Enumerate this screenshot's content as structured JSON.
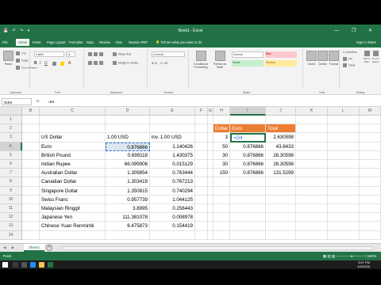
{
  "window": {
    "title": "Book1 - Excel",
    "controls": "— ❐ ✕",
    "qat": "💾 ↶ ↷ ▾"
  },
  "tabs": [
    "File",
    "Home",
    "Insert",
    "Page Layout",
    "Formulas",
    "Data",
    "Review",
    "View",
    "Nuance PDF"
  ],
  "active_tab": "Home",
  "tell_me": "Tell me what you want to do",
  "account": "Sign in  Share",
  "ribbon": {
    "clipboard": {
      "paste": "Paste",
      "cut": "Cut",
      "copy": "Copy",
      "format_painter": "Format Painter",
      "label": "Clipboard"
    },
    "font": {
      "name": "Calibri",
      "size": "11",
      "label": "Font"
    },
    "alignment": {
      "wrap": "Wrap Text",
      "merge": "Merge & Center",
      "label": "Alignment"
    },
    "number": {
      "format": "General",
      "label": "Number"
    },
    "styles": {
      "conditional": "Conditional Formatting",
      "format_table": "Format as Table",
      "normal": "Normal",
      "bad": "Bad",
      "good": "Good",
      "neutral": "Neutral",
      "label": "Styles"
    },
    "cells": {
      "insert": "Insert",
      "delete": "Delete",
      "format": "Format",
      "label": "Cells"
    },
    "editing": {
      "autosum": "AutoSum",
      "fill": "Fill",
      "clear": "Clear",
      "sort": "Sort & Filter",
      "find": "Find & Select",
      "label": "Editing"
    }
  },
  "formula_bar": {
    "name_box": "SUM",
    "fx": "fx",
    "formula": "=D4"
  },
  "columns": [
    "B",
    "C",
    "D",
    "E",
    "F",
    "G",
    "H",
    "I",
    "J",
    "K",
    "L",
    "M"
  ],
  "selected_column": "I",
  "rows": [
    "1",
    "2",
    "3",
    "4",
    "5",
    "6",
    "7",
    "8",
    "9",
    "10",
    "11",
    "12",
    "13",
    "14"
  ],
  "selected_row": "4",
  "currency_table": {
    "header_rate": "1.00 USD",
    "header_inv": "inv. 1.00 USD",
    "base": "US Dollar",
    "rows": [
      {
        "name": "Euro",
        "rate": "0.876866",
        "inv": "1.140426"
      },
      {
        "name": "British Pound",
        "rate": "0.699118",
        "inv": "1.430375"
      },
      {
        "name": "Indian Rupee",
        "rate": "66.099906",
        "inv": "0.015129"
      },
      {
        "name": "Australian Dollar",
        "rate": "1.309854",
        "inv": "0.763444"
      },
      {
        "name": "Canadian Dollar",
        "rate": "1.303419",
        "inv": "0.767213"
      },
      {
        "name": "Singapore Dollar",
        "rate": "1.350815",
        "inv": "0.740294"
      },
      {
        "name": "Swiss Franc",
        "rate": "0.957739",
        "inv": "1.044125"
      },
      {
        "name": "Malaysian Ringgit",
        "rate": "3.8995",
        "inv": "0.256443"
      },
      {
        "name": "Japanese Yen",
        "rate": "111.381078",
        "inv": "0.008978"
      },
      {
        "name": "Chinese Yuan Renminbi",
        "rate": "6.475873",
        "inv": "0.154419"
      }
    ]
  },
  "calc_table": {
    "headers": [
      "Dollar",
      "Euro",
      "Total"
    ],
    "rows": [
      {
        "dollar": "3",
        "euro": "=D4",
        "total": "2.630598"
      },
      {
        "dollar": "50",
        "euro": "0.876866",
        "total": "43.8433"
      },
      {
        "dollar": "30",
        "euro": "0.876866",
        "total": "26.30598"
      },
      {
        "dollar": "30",
        "euro": "0.876866",
        "total": "26.30598"
      },
      {
        "dollar": "150",
        "euro": "0.876866",
        "total": "131.5299"
      }
    ]
  },
  "sheet_tab": "Sheet1",
  "sheet_nav": "◀ ▶",
  "status": "Point",
  "zoom": "▦  ▥  ▤   — ────●──── +  160%",
  "clock": {
    "time": "3:57 PM",
    "date": "4/4/2016"
  },
  "colors": {
    "excel_green": "#217346",
    "header_orange": "#ed7d31",
    "highlight_blue": "#dce6f1"
  }
}
